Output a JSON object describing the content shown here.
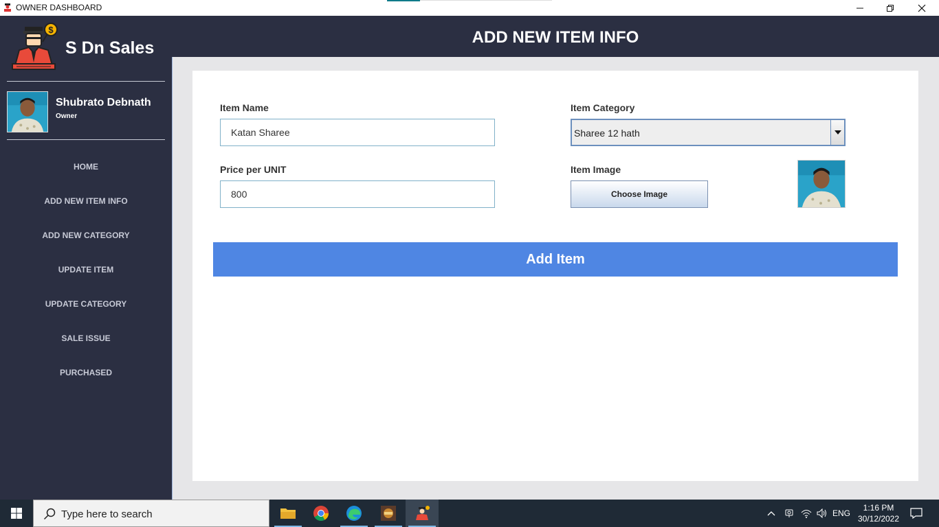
{
  "window": {
    "title": "OWNER DASHBOARD"
  },
  "sidebar": {
    "brand": "S Dn Sales",
    "user_name": "Shubrato Debnath",
    "user_role": "Owner",
    "items": [
      {
        "label": "HOME"
      },
      {
        "label": "ADD NEW ITEM INFO"
      },
      {
        "label": "ADD NEW CATEGORY"
      },
      {
        "label": "UPDATE ITEM"
      },
      {
        "label": "UPDATE CATEGORY"
      },
      {
        "label": "SALE ISSUE"
      },
      {
        "label": "PURCHASED"
      }
    ]
  },
  "header": {
    "title": "ADD NEW ITEM INFO"
  },
  "form": {
    "item_name_label": "Item Name",
    "item_name_value": "Katan Sharee",
    "price_label": "Price per UNIT",
    "price_value": "800",
    "category_label": "Item Category",
    "category_value": "Sharee 12 hath",
    "image_label": "Item Image",
    "choose_image_label": "Choose Image",
    "add_item_label": "Add Item"
  },
  "taskbar": {
    "search_placeholder": "Type here to search",
    "language": "ENG",
    "time": "1:16 PM",
    "date": "30/12/2022"
  },
  "colors": {
    "sidebar_bg": "#2b2f42",
    "accent_button": "#4f86e3",
    "content_bg": "#e6e6e8"
  }
}
